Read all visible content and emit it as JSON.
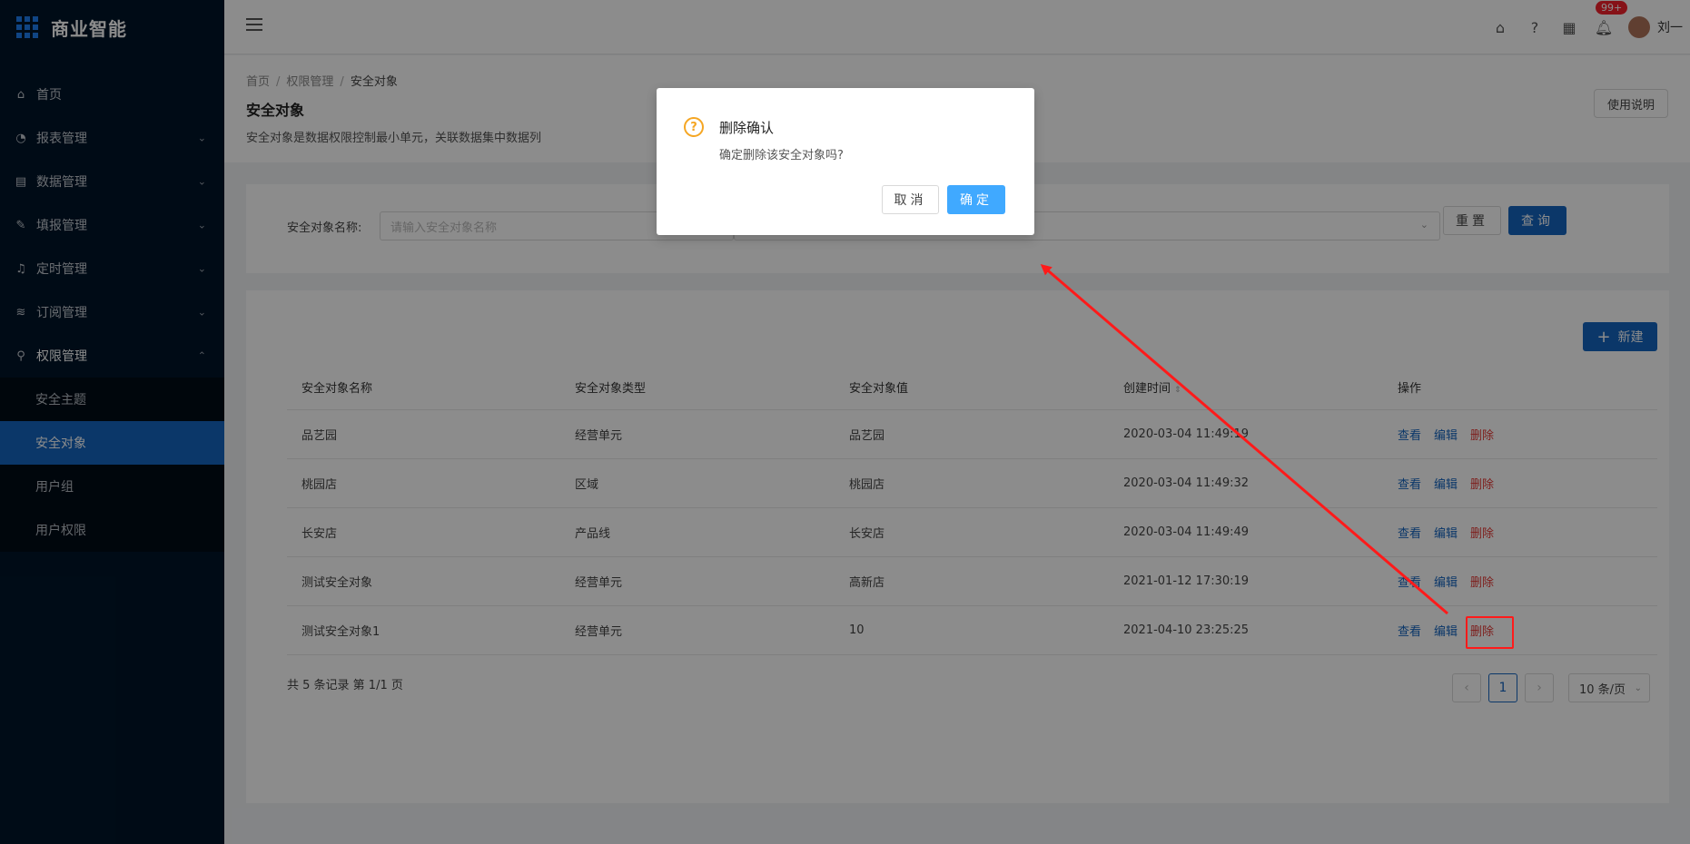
{
  "app": {
    "title": "商业智能"
  },
  "sidebar": {
    "items": [
      {
        "label": "首页",
        "icon": "home-icon"
      },
      {
        "label": "报表管理",
        "icon": "dashboard-icon"
      },
      {
        "label": "数据管理",
        "icon": "database-icon"
      },
      {
        "label": "填报管理",
        "icon": "edit-icon"
      },
      {
        "label": "定时管理",
        "icon": "bell-icon"
      },
      {
        "label": "订阅管理",
        "icon": "wifi-icon"
      },
      {
        "label": "权限管理",
        "icon": "user-icon"
      }
    ],
    "subitems": [
      {
        "label": "安全主题"
      },
      {
        "label": "安全对象"
      },
      {
        "label": "用户组"
      },
      {
        "label": "用户权限"
      }
    ]
  },
  "header": {
    "badge": "99+",
    "username": "刘一"
  },
  "page": {
    "breadcrumb": [
      "首页",
      "权限管理",
      "安全对象"
    ],
    "title": "安全对象",
    "description": "安全对象是数据权限控制最小单元，关联数据集中数据列",
    "help_button": "使用说明"
  },
  "search": {
    "label": "安全对象名称:",
    "placeholder": "请输入安全对象名称",
    "reset": "重置",
    "query": "查询"
  },
  "table": {
    "new_button": "新建",
    "columns": [
      "安全对象名称",
      "安全对象类型",
      "安全对象值",
      "创建时间",
      "操作"
    ],
    "rows": [
      [
        "品艺园",
        "经营单元",
        "品艺园",
        "2020-03-04 11:49:19"
      ],
      [
        "桃园店",
        "区域",
        "桃园店",
        "2020-03-04 11:49:32"
      ],
      [
        "长安店",
        "产品线",
        "长安店",
        "2020-03-04 11:49:49"
      ],
      [
        "测试安全对象",
        "经营单元",
        "高新店",
        "2021-01-12 17:30:19"
      ],
      [
        "测试安全对象1",
        "经营单元",
        "10",
        "2021-04-10 23:25:25"
      ]
    ],
    "actions": {
      "view": "查看",
      "edit": "编辑",
      "delete": "删除"
    }
  },
  "pagination": {
    "summary": "共 5 条记录 第 1/1 页",
    "current": "1",
    "page_size": "10 条/页"
  },
  "modal": {
    "title": "删除确认",
    "text": "确定删除该安全对象吗?",
    "cancel": "取消",
    "ok": "确定"
  },
  "colors": {
    "sidebar_bg": "#001529",
    "primary": "#1565c0",
    "danger": "#e53935",
    "annotation": "#ff1a1a"
  }
}
